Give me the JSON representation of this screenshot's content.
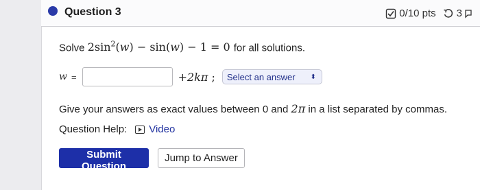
{
  "question": {
    "title": "Question 3",
    "points": "0/10 pts",
    "attempts": "3",
    "colors": {
      "accent": "#1d2fa8",
      "dot": "#2a3aa8"
    }
  },
  "problem": {
    "prefix": "Solve",
    "equation": {
      "coef": "2",
      "fn1": "sin",
      "exp": "2",
      "var": "w",
      "minus": "−",
      "fn2": "sin",
      "minus2": "− 1 = 0"
    },
    "suffix": "for all solutions."
  },
  "answer": {
    "var": "w",
    "eq": "=",
    "input_value": "",
    "period_term": "+2kπ",
    "separator": ";",
    "select_value": "Select an answer"
  },
  "instructions": {
    "text_before": "Give your answers as exact values between 0 and",
    "upper_bound": "2π",
    "text_after": "in a list separated by commas."
  },
  "help": {
    "label": "Question Help:",
    "video_label": "Video"
  },
  "buttons": {
    "submit": "Submit Question",
    "jump": "Jump to Answer"
  }
}
